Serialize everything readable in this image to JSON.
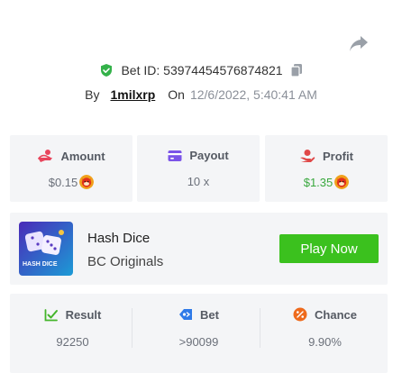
{
  "bet": {
    "id_label": "Bet ID:",
    "id_value": "53974454576874821",
    "by_label": "By",
    "user": "1milxrp",
    "on_label": "On",
    "time": "12/6/2022, 5:40:41 AM"
  },
  "stats": {
    "amount": {
      "label": "Amount",
      "value": "$0.15"
    },
    "payout": {
      "label": "Payout",
      "value": "10 x"
    },
    "profit": {
      "label": "Profit",
      "value": "$1.35"
    }
  },
  "game": {
    "name": "Hash Dice",
    "provider": "BC Originals",
    "thumb_label": "HASH DICE",
    "play_label": "Play Now"
  },
  "results": {
    "result": {
      "label": "Result",
      "value": "92250"
    },
    "bet": {
      "label": "Bet",
      "value": ">90099"
    },
    "chance": {
      "label": "Chance",
      "value": "9.90%"
    }
  },
  "colors": {
    "accent_green": "#3bc11e",
    "profit_green": "#39a83e",
    "amount_icon": "#e8455c",
    "payout_icon": "#7b54e8",
    "profit_icon": "#e04848",
    "result_icon": "#43b52a",
    "bet_icon": "#2f7ae8",
    "chance_icon": "#ee6a1c"
  },
  "icons": {
    "share": "share-icon",
    "shield": "verified-shield-icon",
    "copy": "copy-icon",
    "amount": "amount-icon",
    "payout": "card-icon",
    "profit": "profit-hand-icon",
    "result": "result-check-icon",
    "bet_type": "bet-tag-icon",
    "chance": "percent-icon",
    "currency": "shib-coin-icon"
  }
}
